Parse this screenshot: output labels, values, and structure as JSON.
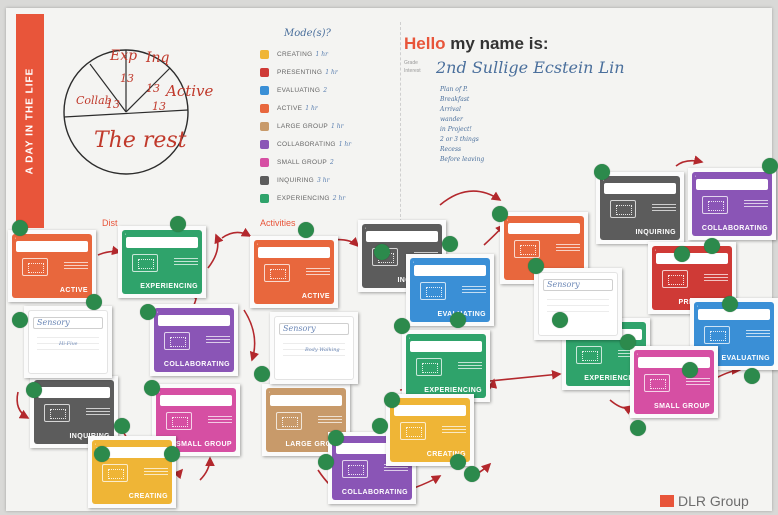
{
  "title_band": "A DAY IN THE LIFE",
  "pie": {
    "exp": "Exp",
    "exp_value": "13",
    "inq": "Inq",
    "inq_value": "13",
    "collab": "Collab",
    "collab_value": "13",
    "active": "Active",
    "active_value": "13",
    "rest": "The rest"
  },
  "legend": {
    "heading": "Mode(s)?",
    "items": [
      {
        "label": "CREATING",
        "note": "1 hr",
        "color": "#efb536"
      },
      {
        "label": "PRESENTING",
        "note": "1 hr",
        "color": "#cf3a36"
      },
      {
        "label": "EVALUATING",
        "note": "2",
        "color": "#3a8fd6"
      },
      {
        "label": "ACTIVE",
        "note": "1 hr",
        "color": "#e8673d"
      },
      {
        "label": "LARGE GROUP",
        "note": "1 hr",
        "color": "#c89a6a"
      },
      {
        "label": "COLLABORATING",
        "note": "1 hr",
        "color": "#8a55b6"
      },
      {
        "label": "SMALL GROUP",
        "note": "2",
        "color": "#d64fa3"
      },
      {
        "label": "INQUIRING",
        "note": "3 hr",
        "color": "#5c5c5c"
      },
      {
        "label": "EXPERIENCING",
        "note": "2 hr",
        "color": "#2fa36b"
      }
    ]
  },
  "header": {
    "hello": "Hello",
    "my_name_is": "my name is:",
    "grade_label": "Grade",
    "interest_label": "Interest",
    "name_written": "2nd Sullige Ecstein Lin"
  },
  "notes": [
    "Plan of P.",
    "Breakfast",
    "Arrival",
    "wander",
    "in Project!",
    "2 or 3 things",
    "Recess",
    "Before leaving"
  ],
  "sections": {
    "dist": "Dist",
    "activities": "Activities"
  },
  "cards": [
    {
      "title": "ACTIVE",
      "color": "#e8673d"
    },
    {
      "title": "EXPERIENCING",
      "color": "#2fa36b"
    },
    {
      "title": "ACTIVE",
      "color": "#e8673d"
    },
    {
      "title": "INQUIRING",
      "color": "#5c5c5c"
    },
    {
      "title": "",
      "color": "#e8673d"
    },
    {
      "title": "INQUIRING",
      "color": "#5c5c5c"
    },
    {
      "title": "COLLABORATING",
      "color": "#8a55b6"
    },
    {
      "title": "EVALUATING",
      "color": "#3a8fd6"
    },
    {
      "title": "COLLABORATING",
      "color": "#8a55b6"
    },
    {
      "title": "PRESENTING",
      "color": "#cf3a36"
    },
    {
      "title": "EXPERIENCING",
      "color": "#2fa36b"
    },
    {
      "title": "EXPERIENCING",
      "color": "#2fa36b"
    },
    {
      "title": "EVALUATING",
      "color": "#3a8fd6"
    },
    {
      "title": "SMALL GROUP",
      "color": "#d64fa3"
    },
    {
      "title": "INQUIRING",
      "color": "#5c5c5c"
    },
    {
      "title": "SMALL GROUP",
      "color": "#d64fa3"
    },
    {
      "title": "LARGE GROUP",
      "color": "#c89a6a"
    },
    {
      "title": "CREATING",
      "color": "#efb536"
    },
    {
      "title": "COLLABORATING",
      "color": "#8a55b6"
    },
    {
      "title": "CREATING",
      "color": "#efb536"
    }
  ],
  "blank_cards": [
    {
      "label": "Sensory",
      "note": "Hi-Five"
    },
    {
      "label": "Sensory",
      "note": "Body Walking"
    },
    {
      "label": "Sensory",
      "note": ""
    }
  ],
  "logo": "DLR Group"
}
